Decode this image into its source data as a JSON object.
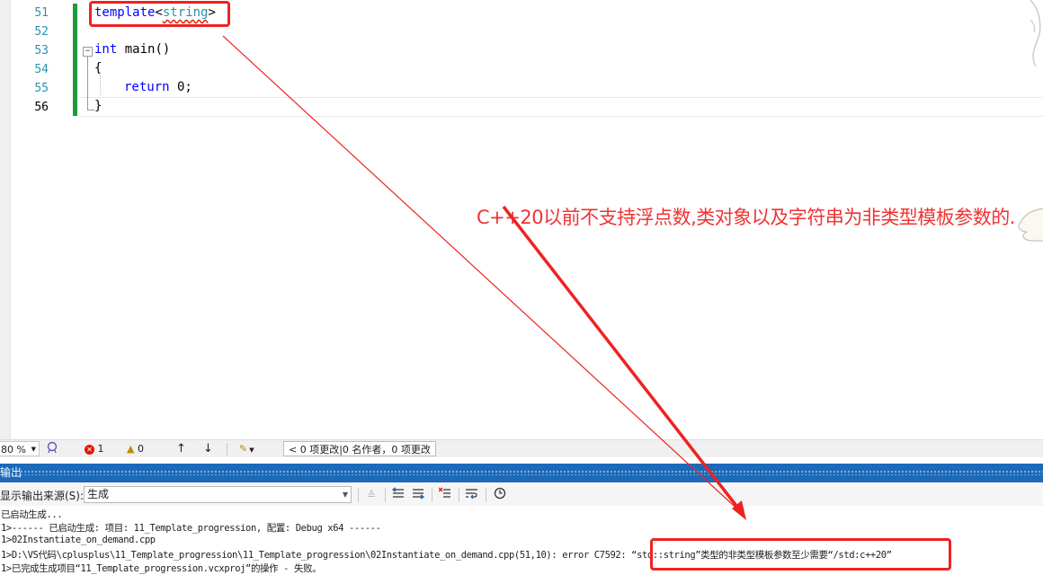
{
  "editor": {
    "lines": [
      {
        "num": "51",
        "text": "template<string>"
      },
      {
        "num": "52",
        "text": ""
      },
      {
        "num": "53",
        "text": "int main()"
      },
      {
        "num": "54",
        "text": "{"
      },
      {
        "num": "55",
        "text": "return 0;"
      },
      {
        "num": "56",
        "text": "}"
      }
    ],
    "tokens": {
      "template_kw": "template",
      "lt": "<",
      "string_type": "string",
      "gt": ">",
      "int_kw": "int",
      "main_rest": " main()",
      "return_kw": "return",
      "return_rest": " 0;"
    },
    "collapse_glyph": "−"
  },
  "annotation": {
    "text": "C++20以前不支持浮点数,类对象以及字符串为非类型模板参数的.",
    "color": "#ee3333"
  },
  "status_bar": {
    "zoom": "80 %",
    "errors": "1",
    "warnings": "0",
    "changes": "0 项更改|0 名作者，0 项更改"
  },
  "output_panel": {
    "title": "输出",
    "source_label": "显示输出来源(S):",
    "source_value": "生成",
    "lines": [
      "已启动生成...",
      "1>------ 已启动生成: 项目: 11_Template_progression, 配置: Debug x64 ------",
      "1>02Instantiate_on_demand.cpp",
      "1>D:\\VS代码\\cplusplus\\11_Template_progression\\11_Template_progression\\02Instantiate_on_demand.cpp(51,10): error C7592: “std::string”类型的非类型模板参数至少需要“/std:c++20”",
      "1>已完成生成项目“11_Template_progression.vcxproj”的操作 - 失败。"
    ]
  },
  "colors": {
    "accent_blue": "#1c6ab9",
    "highlight_red": "#ee2222",
    "change_bar_green": "#1a9b3d"
  },
  "icons": {
    "error": "circle-x-icon",
    "warning": "triangle-warning-icon",
    "up": "arrow-up-icon",
    "down": "arrow-down-icon"
  }
}
